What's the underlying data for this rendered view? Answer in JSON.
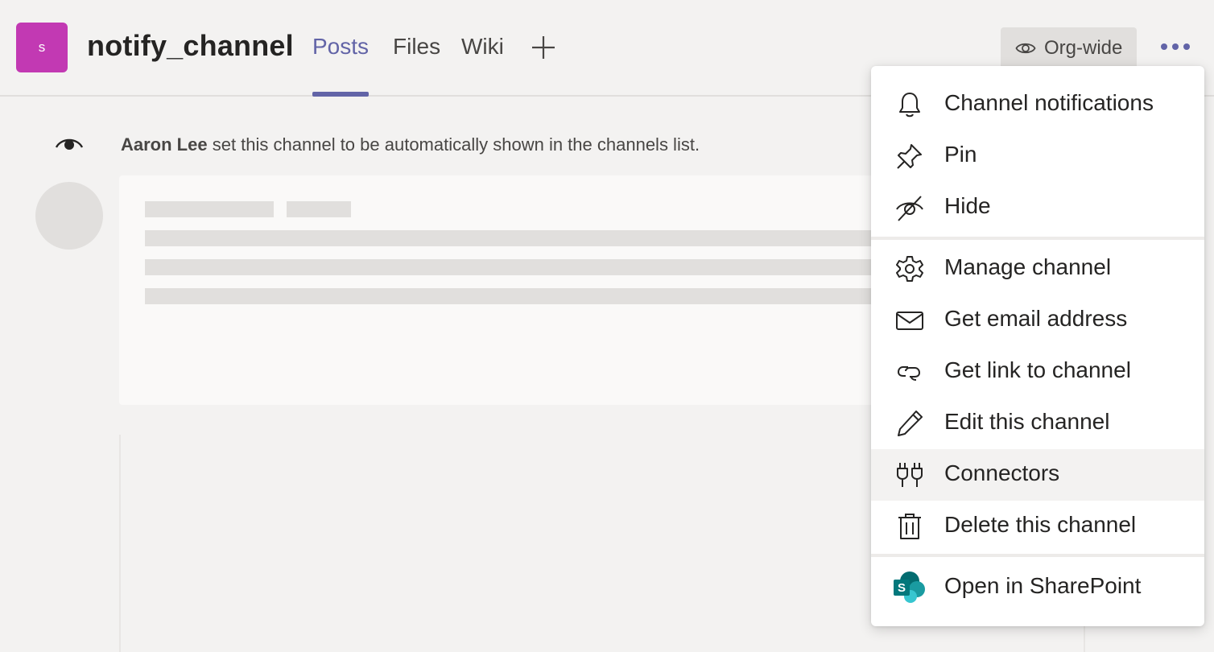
{
  "header": {
    "team_initial": "s",
    "channel_name": "notify_channel",
    "tabs": [
      {
        "label": "Posts",
        "active": true
      },
      {
        "label": "Files",
        "active": false
      },
      {
        "label": "Wiki",
        "active": false
      }
    ],
    "org_wide_label": "Org-wide"
  },
  "feed": {
    "system_message": {
      "actor": "Aaron Lee",
      "text": " set this channel to be automatically shown in the channels list."
    }
  },
  "menu": {
    "items": [
      {
        "label": "Channel notifications",
        "icon": "bell-icon"
      },
      {
        "label": "Pin",
        "icon": "pin-icon"
      },
      {
        "label": "Hide",
        "icon": "eye-off-icon"
      },
      {
        "label": "Manage channel",
        "icon": "gear-icon"
      },
      {
        "label": "Get email address",
        "icon": "mail-icon"
      },
      {
        "label": "Get link to channel",
        "icon": "link-icon"
      },
      {
        "label": "Edit this channel",
        "icon": "pencil-icon"
      },
      {
        "label": "Connectors",
        "icon": "plug-icon"
      },
      {
        "label": "Delete this channel",
        "icon": "trash-icon"
      },
      {
        "label": "Open in SharePoint",
        "icon": "sharepoint-icon"
      }
    ],
    "hovered": "Connectors"
  },
  "colors": {
    "accent": "#6264a7",
    "team_avatar": "#c239b3",
    "background": "#f3f2f1",
    "sharepoint": "#036c70"
  }
}
